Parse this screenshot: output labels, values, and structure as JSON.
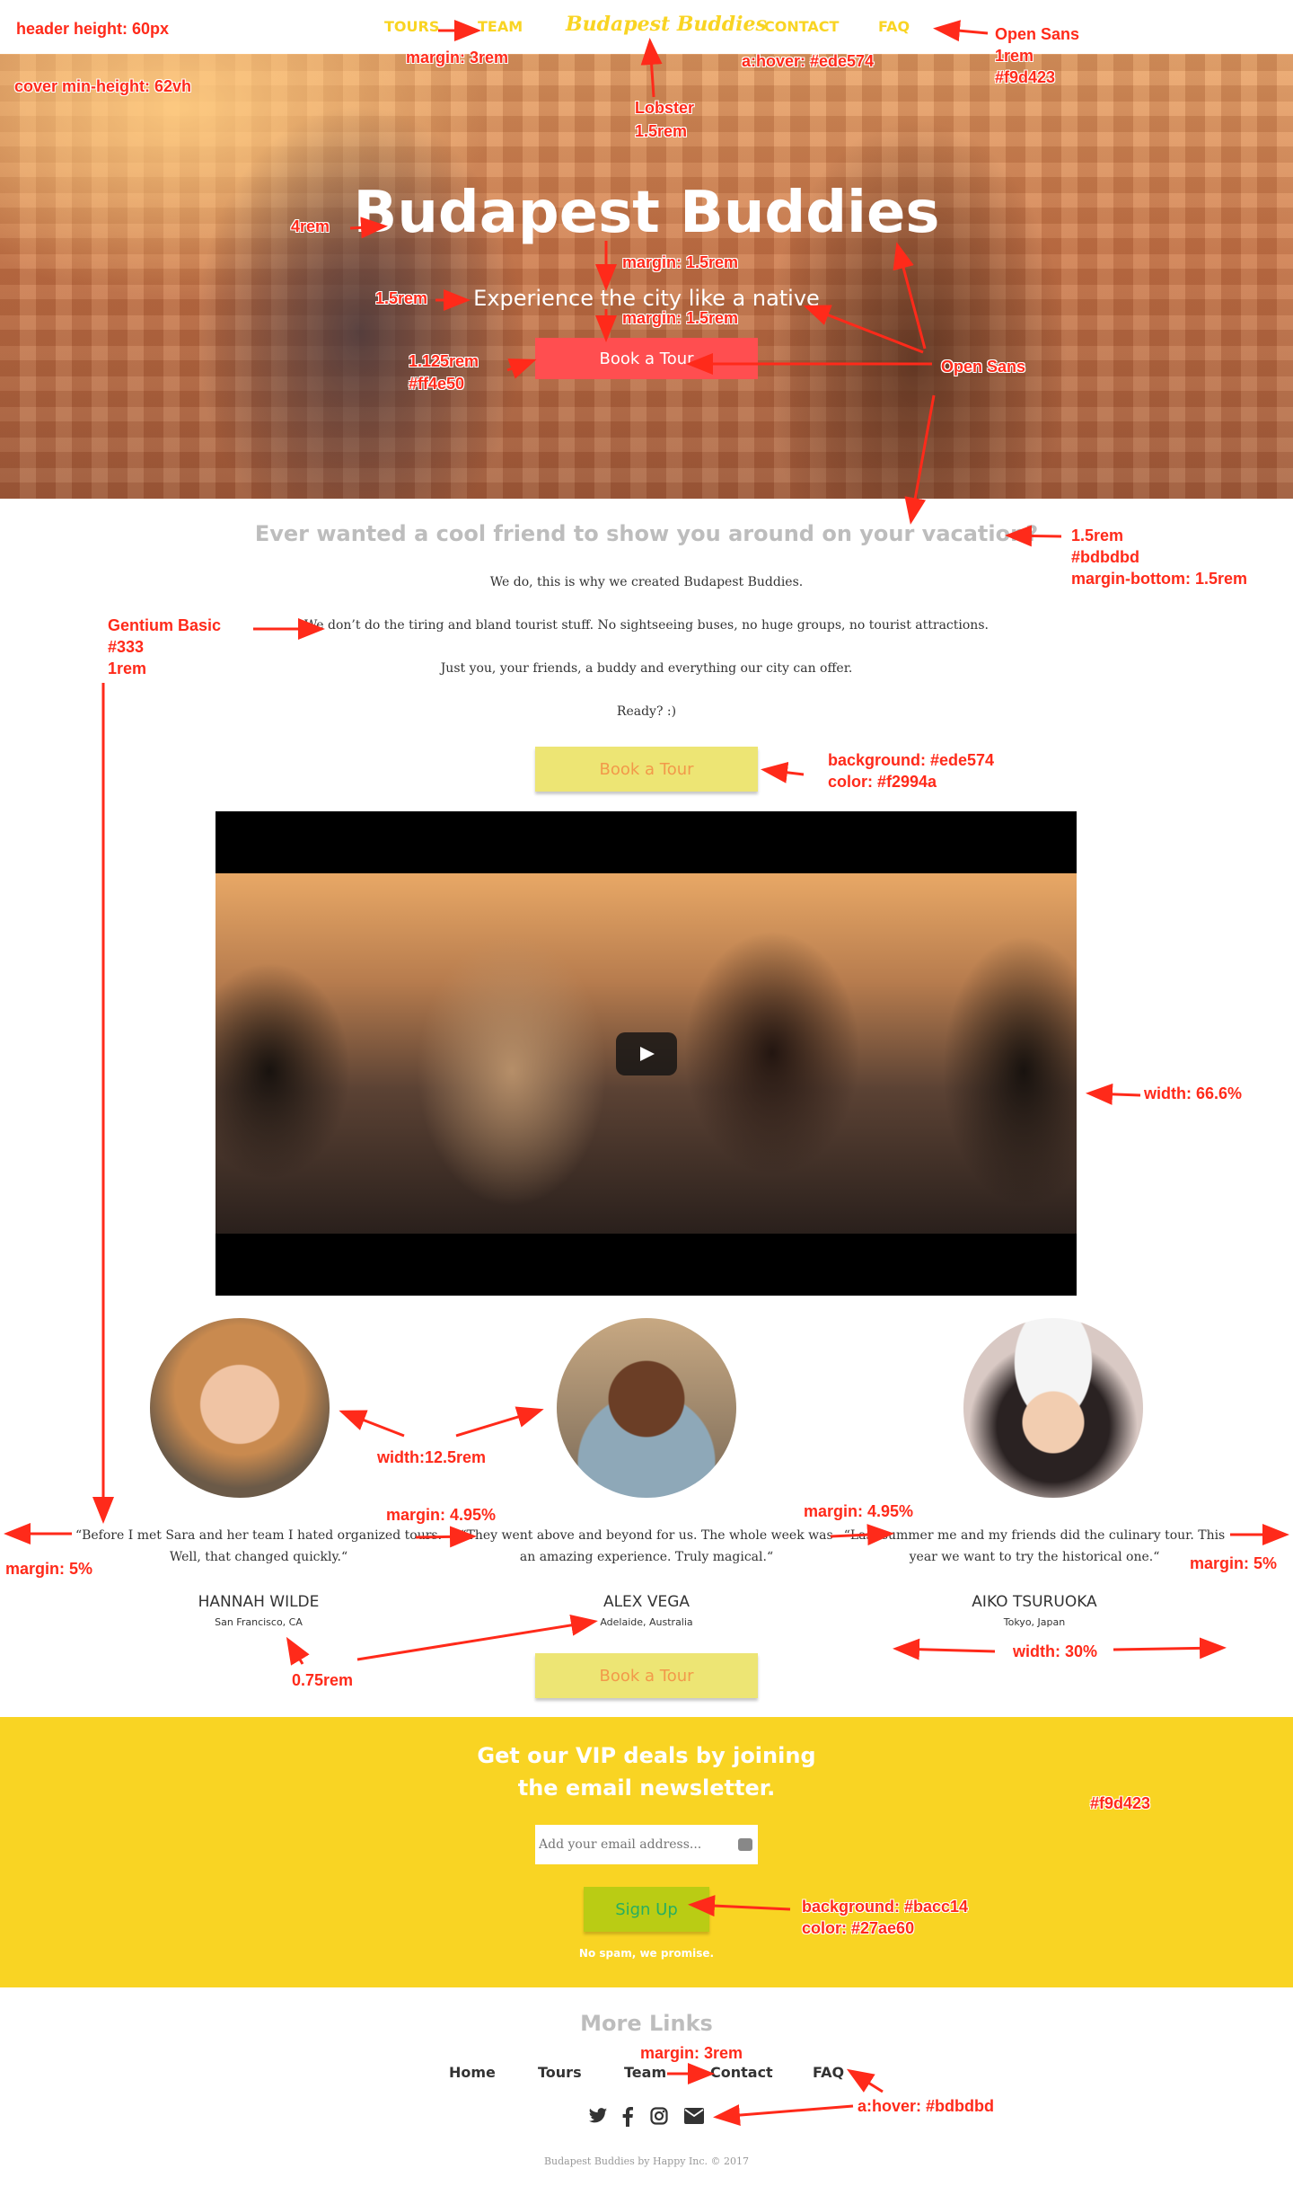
{
  "header": {
    "nav_tours": "TOURS",
    "nav_team": "TEAM",
    "brand": "Budapest Buddies",
    "nav_contact": "CONTACT",
    "nav_faq": "FAQ"
  },
  "cover": {
    "title": "Budapest Buddies",
    "subtitle": "Experience the city like a native",
    "button": "Book a Tour"
  },
  "intro": {
    "heading": "Ever wanted a cool friend to show you around on your vacation?",
    "p1": "We do, this is why we created Budapest Buddies.",
    "p2": "We don’t do the tiring and bland tourist stuff. No sightseeing buses, no huge groups, no tourist attractions.",
    "p3": "Just you, your friends, a buddy and everything our city can offer.",
    "p4": "Ready? :)",
    "button": "Book a Tour"
  },
  "testimonials": [
    {
      "quote": "“Before I met Sara and her team I hated organized tours. Well, that changed quickly.“",
      "name": "HANNAH WILDE",
      "location": "San Francisco, CA"
    },
    {
      "quote": "“They went above and beyond for us. The whole week was an amazing experience. Truly magical.“",
      "name": "ALEX VEGA",
      "location": "Adelaide, Australia"
    },
    {
      "quote": "“Last summer me and my friends did the culinary tour. This year we want to try the historical one.“",
      "name": "AIKO TSURUOKA",
      "location": "Tokyo, Japan"
    }
  ],
  "testimonials_button": "Book a Tour",
  "newsletter": {
    "heading_line1": "Get our VIP deals by joining",
    "heading_line2": "the email newsletter.",
    "placeholder": "Add your email address...",
    "button": "Sign Up",
    "note": "No spam, we promise."
  },
  "footer": {
    "heading": "More Links",
    "links": [
      "Home",
      "Tours",
      "Team",
      "Contact",
      "FAQ"
    ],
    "social_icons": [
      "twitter-icon",
      "facebook-icon",
      "instagram-icon",
      "envelope-icon"
    ],
    "copyright": "Budapest Buddies by Happy Inc. © 2017"
  },
  "annotations": {
    "header_height": "header height: 60px",
    "cover_min_height": "cover min-height: 62vh",
    "nav_margin": "margin: 3rem",
    "hover_color": "a:hover: #ede574",
    "font_open_sans": "Open Sans",
    "nav_font_size": "1rem",
    "nav_color": "#f9d423",
    "brand_font": "Lobster",
    "brand_size": "1.5rem",
    "title_size": "4rem",
    "title_margin": "margin: 1.5rem",
    "subtitle_size": "1.5rem",
    "subtitle_margin": "margin: 1.5rem",
    "btn_size": "1.125rem",
    "btn_color": "#ff4e50",
    "cover_font": "Open Sans",
    "intro_size": "1.5rem",
    "intro_color": "#bdbdbd",
    "intro_margin": "margin-bottom: 1.5rem",
    "body_font": "Gentium Basic",
    "body_color": "#333",
    "body_size": "1rem",
    "yellow_bg": "background: #ede574",
    "yellow_color": "color: #f2994a",
    "video_width": "width: 66.6%",
    "avatar_width": "width:12.5rem",
    "margin_495_a": "margin: 4.95%",
    "margin_495_b": "margin: 4.95%",
    "margin_5_left": "margin: 5%",
    "margin_5_right": "margin: 5%",
    "loc_size": "0.75rem",
    "col_width": "width: 30%",
    "newsletter_color": "#f9d423",
    "signup_bg": "background: #bacc14",
    "signup_color": "color: #27ae60",
    "footer_margin": "margin: 3rem",
    "footer_hover": "a:hover: #bdbdbd"
  }
}
